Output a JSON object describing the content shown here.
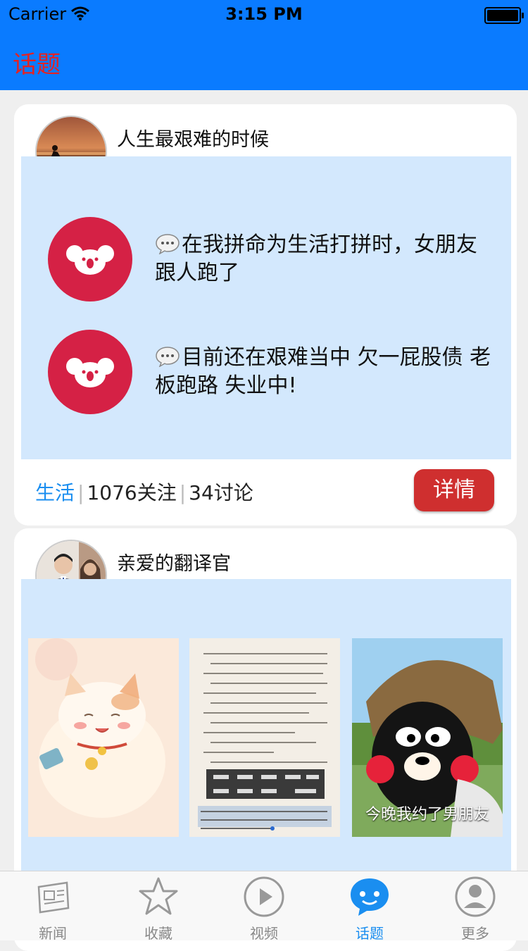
{
  "status": {
    "carrier": "Carrier",
    "time": "3:15 PM"
  },
  "nav": {
    "title": "话题"
  },
  "topics": [
    {
      "title": "人生最艰难的时候",
      "comments": [
        {
          "text": "在我拼命为生活打拼时，女朋友跟人跑了"
        },
        {
          "text": "目前还在艰难当中 欠一屁股债 老板跑路 失业中!"
        }
      ],
      "tag": "生活",
      "followers": "1076关注",
      "discussions": "34讨论",
      "detail_label": "详情"
    },
    {
      "title": "亲爱的翻译官",
      "images": [
        {
          "caption": ""
        },
        {
          "caption": ""
        },
        {
          "caption": "今晚我约了男朋友"
        }
      ]
    }
  ],
  "tabbar": {
    "items": [
      {
        "label": "新闻",
        "icon": "newspaper-icon"
      },
      {
        "label": "收藏",
        "icon": "star-icon"
      },
      {
        "label": "视频",
        "icon": "play-icon"
      },
      {
        "label": "话题",
        "icon": "chat-icon"
      },
      {
        "label": "更多",
        "icon": "person-icon"
      }
    ],
    "active_index": 3
  },
  "colors": {
    "header": "#0a7bff",
    "title": "#e52222",
    "accent": "#1a8ef0",
    "detail_button": "#cf2f2f",
    "panel": "#d3e8fd",
    "koala_badge": "#d52145"
  }
}
